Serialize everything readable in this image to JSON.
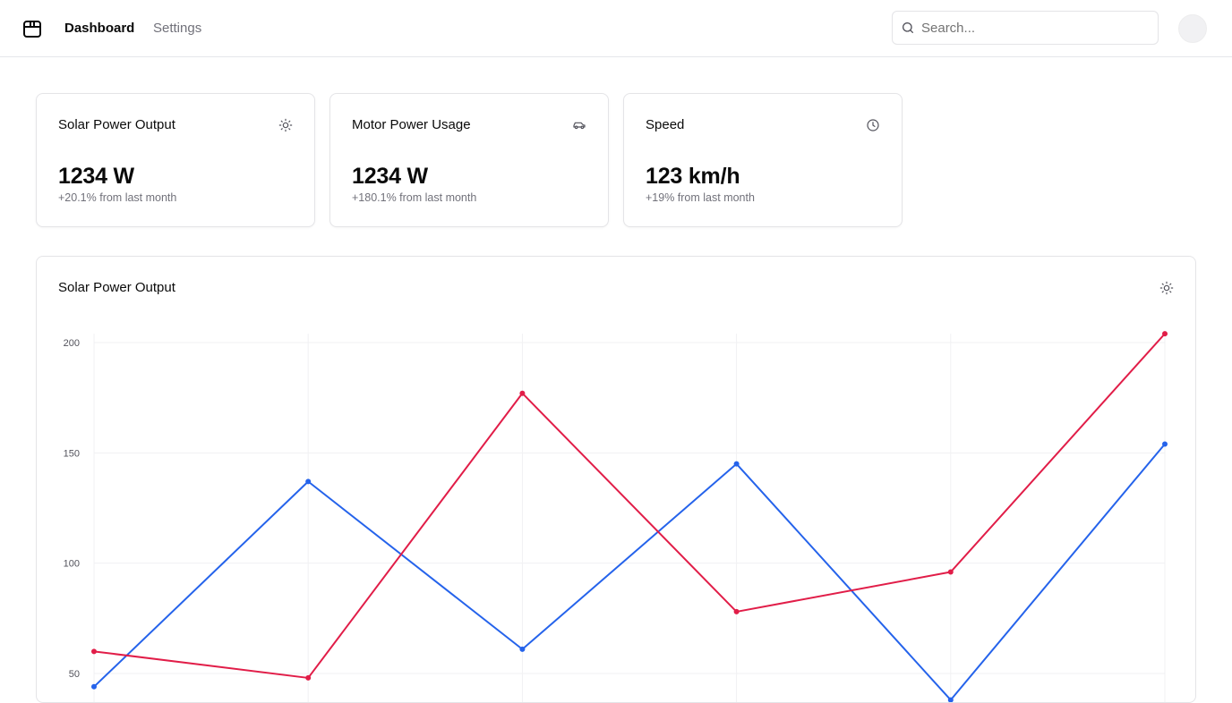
{
  "header": {
    "logo_icon": "package-icon",
    "nav": [
      {
        "label": "Dashboard",
        "active": true
      },
      {
        "label": "Settings",
        "active": false
      }
    ],
    "search": {
      "placeholder": "Search...",
      "value": ""
    },
    "avatar": "avatar"
  },
  "stats": [
    {
      "title": "Solar Power Output",
      "icon": "sun-icon",
      "value": "1234 W",
      "change": "+20.1% from last month"
    },
    {
      "title": "Motor Power Usage",
      "icon": "car-icon",
      "value": "1234 W",
      "change": "+180.1% from last month"
    },
    {
      "title": "Speed",
      "icon": "clock-icon",
      "value": "123 km/h",
      "change": "+19% from last month"
    }
  ],
  "chart": {
    "title": "Solar Power Output",
    "icon": "sun-icon"
  },
  "colors": {
    "series_blue": "#2563eb",
    "series_red": "#e11d48",
    "border": "#e4e4e7",
    "muted_text": "#71717a"
  },
  "chart_data": {
    "type": "line",
    "x": [
      0,
      1,
      2,
      3,
      4,
      5
    ],
    "series": [
      {
        "color": "#2563eb",
        "values": [
          44,
          137,
          61,
          145,
          38,
          154
        ]
      },
      {
        "color": "#e11d48",
        "values": [
          60,
          48,
          177,
          78,
          96,
          204
        ]
      }
    ],
    "yticks": [
      50,
      100,
      150,
      200
    ],
    "ylim": [
      0,
      204
    ],
    "grid": true,
    "title": "",
    "xlabel": "",
    "ylabel": ""
  }
}
